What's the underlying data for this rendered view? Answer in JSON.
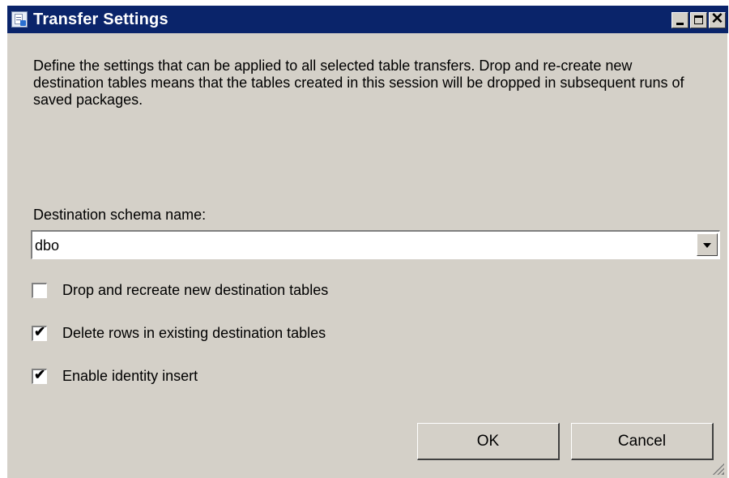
{
  "window": {
    "title": "Transfer Settings",
    "controls": {
      "minimize_icon": "minimize-icon",
      "maximize_icon": "maximize-icon",
      "close_label": "✕"
    }
  },
  "description": "Define the settings that can be applied to all selected table transfers. Drop and re-create new destination tables means that the tables created in this session will be dropped in subsequent runs of saved packages.",
  "schema": {
    "label": "Destination schema name:",
    "value": "dbo"
  },
  "options": [
    {
      "label": "Drop and recreate new destination tables",
      "checked": false
    },
    {
      "label": "Delete rows in existing destination tables",
      "checked": true
    },
    {
      "label": "Enable identity insert",
      "checked": true
    }
  ],
  "buttons": {
    "ok": "OK",
    "cancel": "Cancel"
  },
  "colors": {
    "titlebar": "#0a246a",
    "dialog_bg": "#d4d0c8"
  }
}
